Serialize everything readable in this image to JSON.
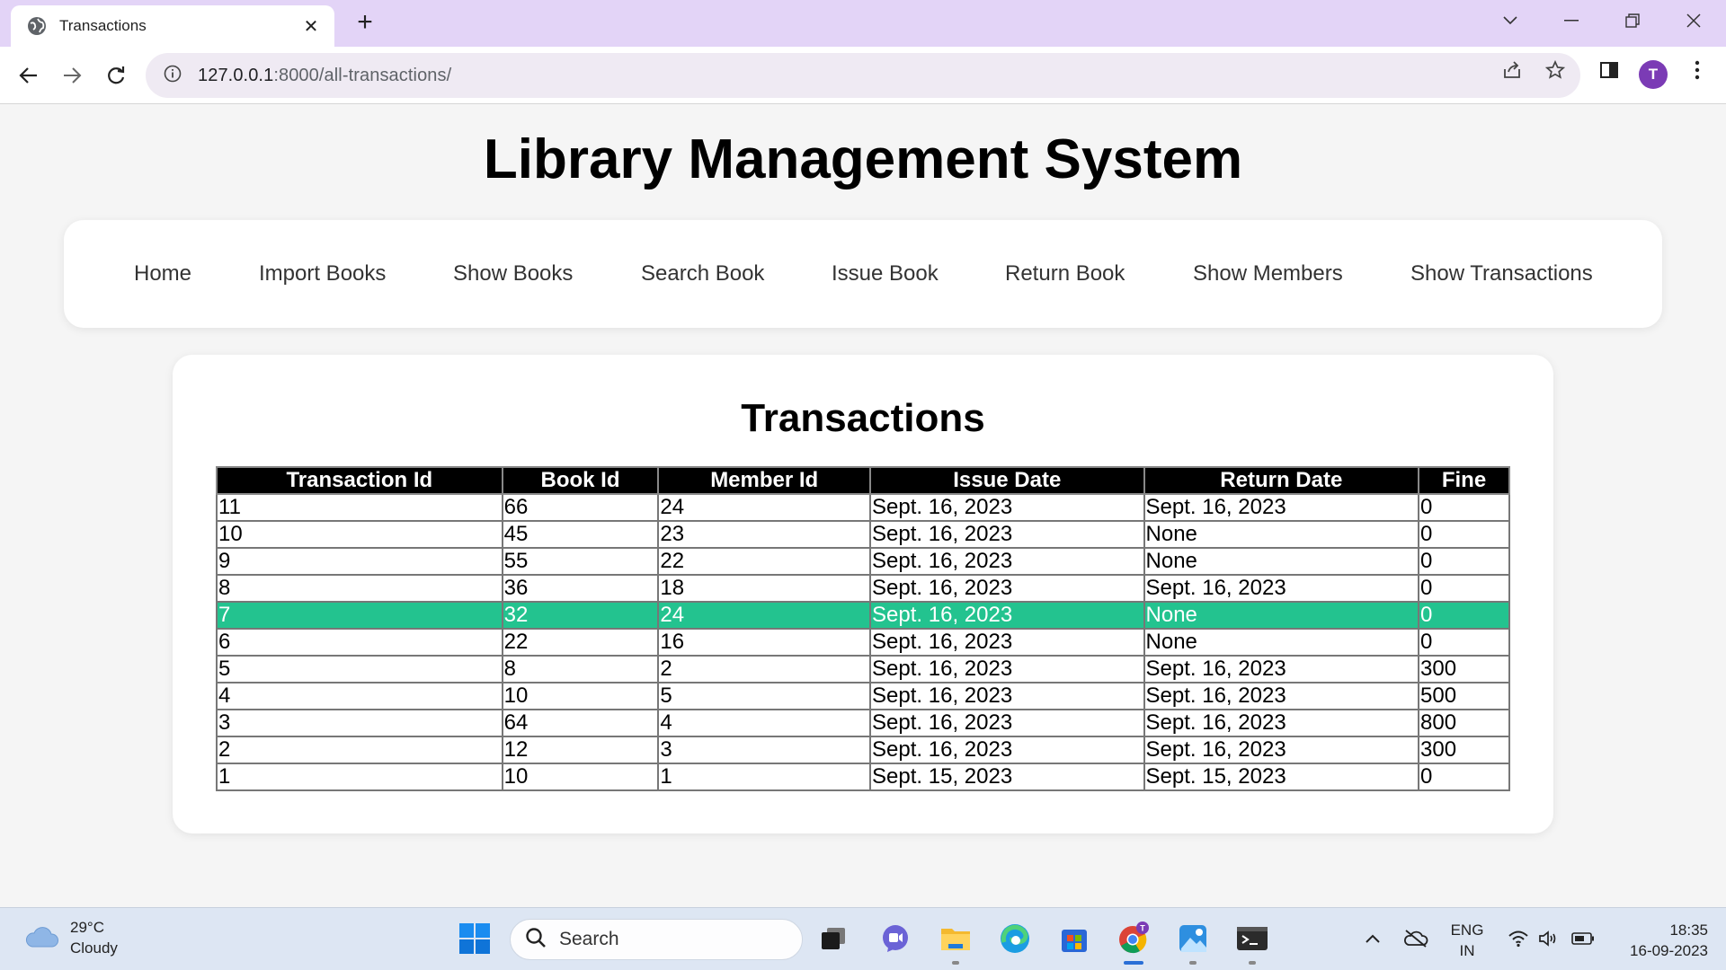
{
  "browser": {
    "tab_title": "Transactions",
    "new_tab_label": "+",
    "url_host": "127.0.0.1",
    "url_path": ":8000/all-transactions/",
    "profile_initial": "T"
  },
  "page": {
    "site_title": "Library Management System",
    "nav": [
      "Home",
      "Import Books",
      "Show Books",
      "Search Book",
      "Issue Book",
      "Return Book",
      "Show Members",
      "Show Transactions"
    ],
    "section_title": "Transactions"
  },
  "table": {
    "columns": [
      "Transaction Id",
      "Book Id",
      "Member Id",
      "Issue Date",
      "Return Date",
      "Fine"
    ],
    "highlighted_row": 4,
    "highlight_color": "#23c38f",
    "rows": [
      [
        "11",
        "66",
        "24",
        "Sept. 16, 2023",
        "Sept. 16, 2023",
        "0"
      ],
      [
        "10",
        "45",
        "23",
        "Sept. 16, 2023",
        "None",
        "0"
      ],
      [
        "9",
        "55",
        "22",
        "Sept. 16, 2023",
        "None",
        "0"
      ],
      [
        "8",
        "36",
        "18",
        "Sept. 16, 2023",
        "Sept. 16, 2023",
        "0"
      ],
      [
        "7",
        "32",
        "24",
        "Sept. 16, 2023",
        "None",
        "0"
      ],
      [
        "6",
        "22",
        "16",
        "Sept. 16, 2023",
        "None",
        "0"
      ],
      [
        "5",
        "8",
        "2",
        "Sept. 16, 2023",
        "Sept. 16, 2023",
        "300"
      ],
      [
        "4",
        "10",
        "5",
        "Sept. 16, 2023",
        "Sept. 16, 2023",
        "500"
      ],
      [
        "3",
        "64",
        "4",
        "Sept. 16, 2023",
        "Sept. 16, 2023",
        "800"
      ],
      [
        "2",
        "12",
        "3",
        "Sept. 16, 2023",
        "Sept. 16, 2023",
        "300"
      ],
      [
        "1",
        "10",
        "1",
        "Sept. 15, 2023",
        "Sept. 15, 2023",
        "0"
      ]
    ]
  },
  "taskbar": {
    "weather_temp": "29°C",
    "weather_desc": "Cloudy",
    "search_label": "Search",
    "lang_primary": "ENG",
    "lang_secondary": "IN",
    "time": "18:35",
    "date": "16-09-2023"
  }
}
